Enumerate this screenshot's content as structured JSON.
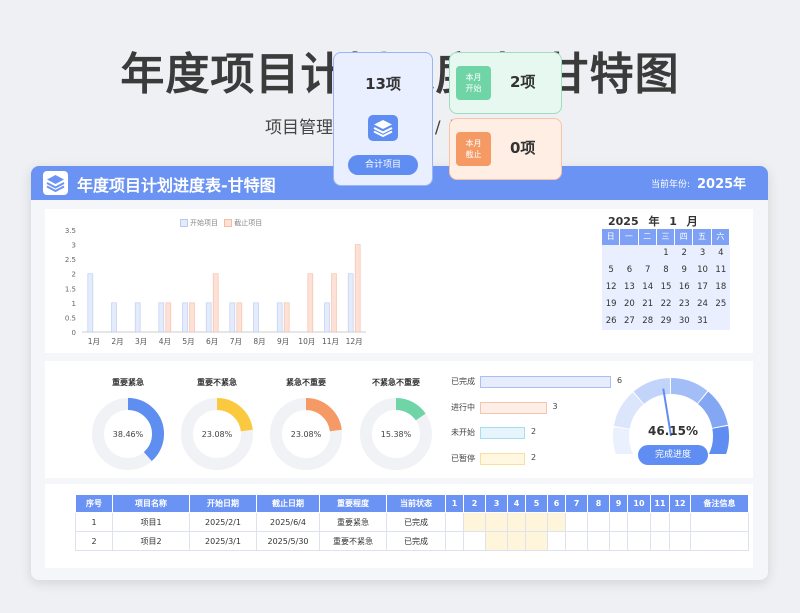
{
  "page": {
    "title": "年度项目计划进度表-甘特图",
    "subtitle": "项目管理 /  自动统计  /  可编辑修改"
  },
  "header": {
    "title": "年度项目计划进度表-甘特图",
    "year_label": "当前年份:",
    "year_value": "2025年",
    "icon": "layers-icon"
  },
  "colors": {
    "accent": "#6b93f3",
    "start_bar": "#e4ebfb",
    "due_bar": "#fde1d6",
    "green": "#6fd4a6",
    "orange": "#f59a64",
    "yellow": "#fbc93f"
  },
  "chart_data": {
    "type": "bar",
    "categories": [
      "1月",
      "2月",
      "3月",
      "4月",
      "5月",
      "6月",
      "7月",
      "8月",
      "9月",
      "10月",
      "11月",
      "12月"
    ],
    "series": [
      {
        "name": "开始项目",
        "values": [
          2,
          1,
          1,
          1,
          1,
          1,
          1,
          1,
          1,
          0,
          1,
          2
        ]
      },
      {
        "name": "截止项目",
        "values": [
          0,
          0,
          0,
          1,
          1,
          2,
          1,
          0,
          1,
          2,
          2,
          3
        ]
      }
    ],
    "y_ticks": [
      "0",
      "0.5",
      "1",
      "1.5",
      "2",
      "2.5",
      "3",
      "3.5"
    ],
    "ylim": [
      0,
      3.5
    ],
    "legend_position": "top-center",
    "grid": false
  },
  "summary": {
    "total_count": "13项",
    "total_label": "合计项目",
    "started_badge": [
      "本月",
      "开始"
    ],
    "started_count": "2项",
    "due_badge": [
      "本月",
      "截止"
    ],
    "due_count": "0项"
  },
  "calendar": {
    "title": "2025 年  1 月",
    "weekdays": [
      "日",
      "一",
      "二",
      "三",
      "四",
      "五",
      "六"
    ],
    "weeks": [
      [
        "",
        "",
        "",
        "1",
        "2",
        "3",
        "4"
      ],
      [
        "5",
        "6",
        "7",
        "8",
        "9",
        "10",
        "11"
      ],
      [
        "12",
        "13",
        "14",
        "15",
        "16",
        "17",
        "18"
      ],
      [
        "19",
        "20",
        "21",
        "22",
        "23",
        "24",
        "25"
      ],
      [
        "26",
        "27",
        "28",
        "29",
        "30",
        "31",
        ""
      ]
    ]
  },
  "importance": [
    {
      "title": "重要紧急",
      "percent": "38.46%",
      "fraction": 0.3846,
      "color": "#5d8ef0"
    },
    {
      "title": "重要不紧急",
      "percent": "23.08%",
      "fraction": 0.2308,
      "color": "#fbc93f"
    },
    {
      "title": "紧急不重要",
      "percent": "23.08%",
      "fraction": 0.2308,
      "color": "#f59a64"
    },
    {
      "title": "不紧急不重要",
      "percent": "15.38%",
      "fraction": 0.1538,
      "color": "#6fd4a6"
    }
  ],
  "status": [
    {
      "label": "已完成",
      "value": "6",
      "fraction": 0.6,
      "fill": "#e6ecfc",
      "border": "#a9c0f5"
    },
    {
      "label": "进行中",
      "value": "3",
      "fraction": 0.3,
      "fill": "#fdeee8",
      "border": "#f6c3ab"
    },
    {
      "label": "未开始",
      "value": "2",
      "fraction": 0.2,
      "fill": "#e6f5fb",
      "border": "#a9dcef"
    },
    {
      "label": "已暂停",
      "value": "2",
      "fraction": 0.2,
      "fill": "#fff7e0",
      "border": "#f6dfa0"
    }
  ],
  "progress": {
    "percent": "46.15%",
    "fraction": 0.4615,
    "label": "完成进度"
  },
  "table": {
    "columns": [
      "序号",
      "项目名称",
      "开始日期",
      "截止日期",
      "重要程度",
      "当前状态",
      "1",
      "2",
      "3",
      "4",
      "5",
      "6",
      "7",
      "8",
      "9",
      "10",
      "11",
      "12",
      "备注信息"
    ],
    "rows": [
      {
        "cells": [
          "1",
          "项目1",
          "2025/2/1",
          "2025/6/4",
          "重要紧急",
          "已完成"
        ],
        "months": [
          2,
          3,
          4,
          5,
          6
        ],
        "note": ""
      },
      {
        "cells": [
          "2",
          "项目2",
          "2025/3/1",
          "2025/5/30",
          "重要不紧急",
          "已完成"
        ],
        "months": [
          3,
          4,
          5
        ],
        "note": ""
      }
    ]
  }
}
